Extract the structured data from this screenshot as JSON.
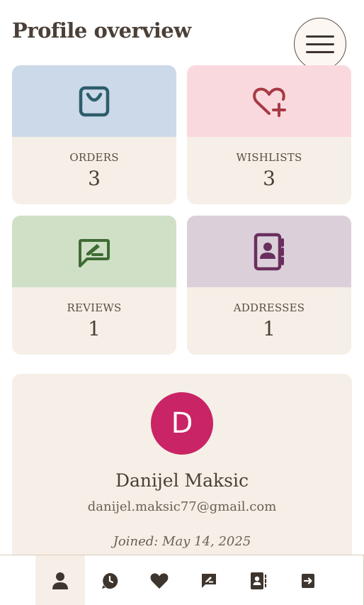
{
  "page": {
    "title": "Profile overview"
  },
  "header": {
    "menu_icon": "hamburger-menu-icon"
  },
  "stats": [
    {
      "label": "ORDERS",
      "count": "3",
      "icon": "shopping-bag-icon",
      "color": "#2e5d6b",
      "bg": "#ccd9e8"
    },
    {
      "label": "WISHLISTS",
      "count": "3",
      "icon": "heart-plus-icon",
      "color": "#a83a45",
      "bg": "#fad9de"
    },
    {
      "label": "REVIEWS",
      "count": "1",
      "icon": "review-comment-icon",
      "color": "#3f6b34",
      "bg": "#cfe0c6"
    },
    {
      "label": "ADDRESSES",
      "count": "1",
      "icon": "address-book-icon",
      "color": "#6a2f5e",
      "bg": "#dbd0d9"
    }
  ],
  "profile": {
    "avatar_letter": "D",
    "avatar_color": "#c92466",
    "name": "Danijel Maksic",
    "email": "danijel.maksic77@gmail.com",
    "joined": "Joined: May 14, 2025"
  },
  "bottom_nav": [
    {
      "icon": "user-icon",
      "active": true
    },
    {
      "icon": "history-icon",
      "active": false
    },
    {
      "icon": "heart-icon",
      "active": false
    },
    {
      "icon": "review-icon",
      "active": false
    },
    {
      "icon": "address-book-icon",
      "active": false
    },
    {
      "icon": "logout-icon",
      "active": false
    }
  ]
}
